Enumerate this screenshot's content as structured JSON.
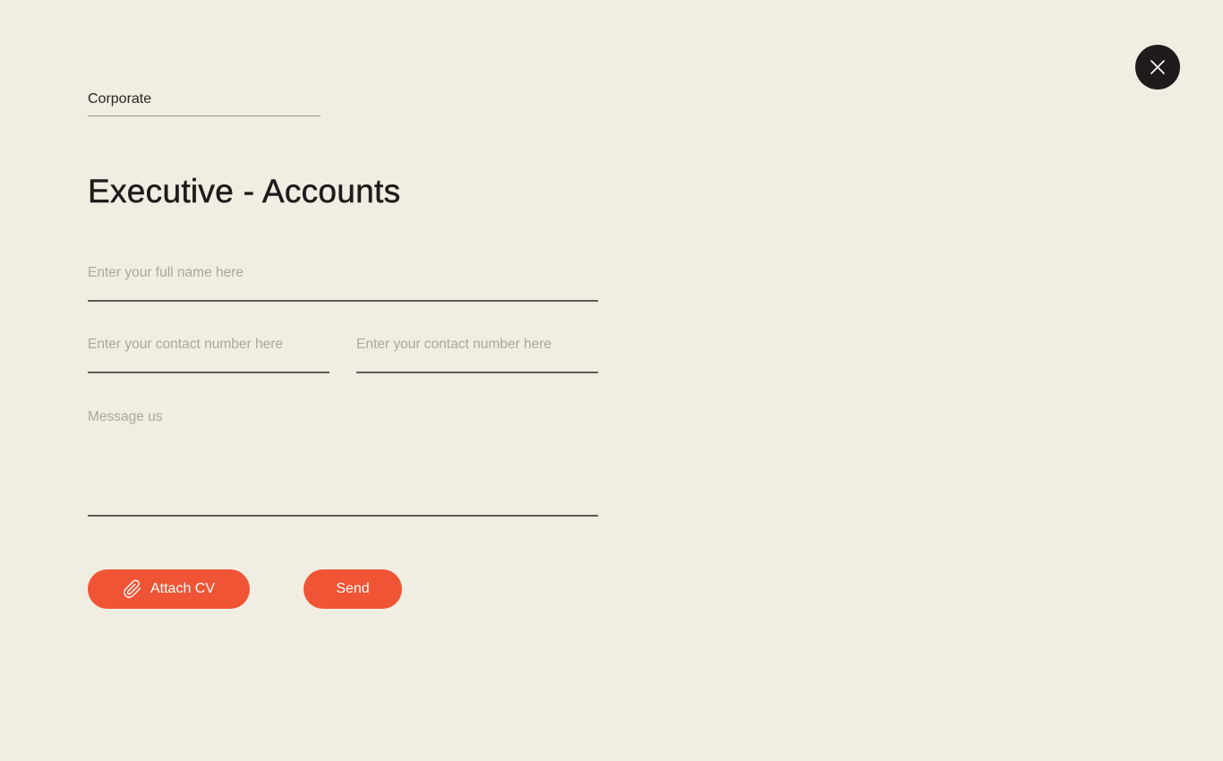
{
  "close": {
    "icon": "close-icon"
  },
  "category": {
    "value": "Corporate"
  },
  "title": "Executive - Accounts",
  "form": {
    "full_name_placeholder": "Enter your full name here",
    "contact_placeholder_1": "Enter your contact number here",
    "contact_placeholder_2": "Enter your contact number here",
    "message_placeholder": "Message us"
  },
  "buttons": {
    "attach_label": "Attach CV",
    "attach_icon": "paperclip-icon",
    "send_label": "Send"
  },
  "colors": {
    "background": "#f0ede2",
    "accent": "#ef5434",
    "dark": "#1e1b1a"
  }
}
